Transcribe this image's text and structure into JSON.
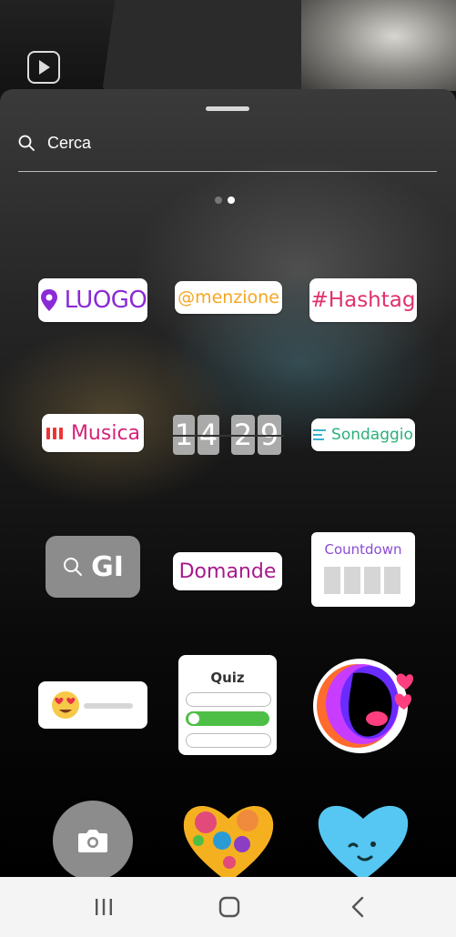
{
  "search": {
    "placeholder": "Cerca"
  },
  "pager": {
    "pages": 2,
    "active_index": 1
  },
  "stickers": {
    "location": "LUOGO",
    "mention": "@menzione",
    "hashtag": "#Hashtag",
    "music": "Musica",
    "time": {
      "d1": "1",
      "d2": "4",
      "d3": "2",
      "d4": "9"
    },
    "poll": "Sondaggio",
    "gif": "GI",
    "questions": "Domande",
    "countdown": "Countdown",
    "quiz": "Quiz"
  },
  "colors": {
    "accent_purple": "#8a2bd6",
    "mention_orange": "#f5a623",
    "hashtag_pink": "#e1306c",
    "music_red": "#e33"
  },
  "icons": [
    "search-icon",
    "location-pin-icon",
    "music-bars-icon",
    "poll-lines-icon",
    "gif-search-icon",
    "emoji-heart-eyes-icon",
    "camera-icon",
    "recent-apps-icon",
    "home-icon",
    "back-icon"
  ]
}
